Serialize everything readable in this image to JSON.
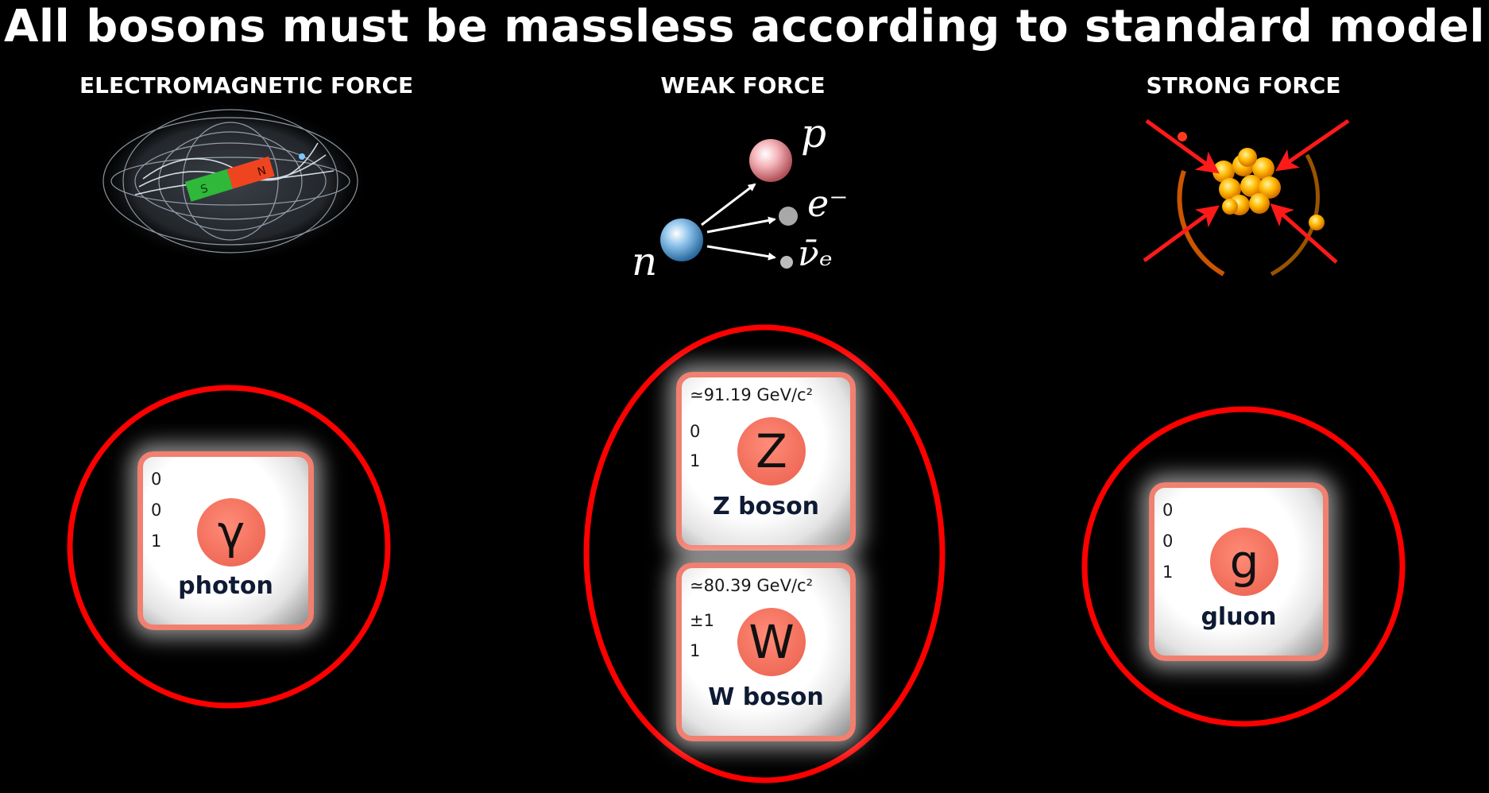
{
  "title": "All bosons must be massless according to standard model",
  "forces": {
    "em": {
      "label": "ELECTROMAGNETIC FORCE",
      "magnet_s": "S",
      "magnet_n": "N"
    },
    "weak": {
      "label": "WEAK FORCE",
      "n": "n",
      "p": "p",
      "e": "e⁻",
      "nu": "ν̄ₑ"
    },
    "strong": {
      "label": "STRONG FORCE"
    }
  },
  "bosons": {
    "photon": {
      "v1": "0",
      "v2": "0",
      "v3": "1",
      "symbol": "γ",
      "name": "photon"
    },
    "z": {
      "mass": "≃91.19 GeV/c²",
      "v2": "0",
      "v3": "1",
      "symbol": "Z",
      "name": "Z boson"
    },
    "w": {
      "mass": "≃80.39 GeV/c²",
      "v2": "±1",
      "v3": "1",
      "symbol": "W",
      "name": "W boson"
    },
    "gluon": {
      "v1": "0",
      "v2": "0",
      "v3": "1",
      "symbol": "g",
      "name": "gluon"
    }
  },
  "colors": {
    "highlight_ring": "#ff0000",
    "card_border": "#f08070",
    "boson_circle": "#f2705d",
    "arrow_red": "#ff1a1a"
  }
}
